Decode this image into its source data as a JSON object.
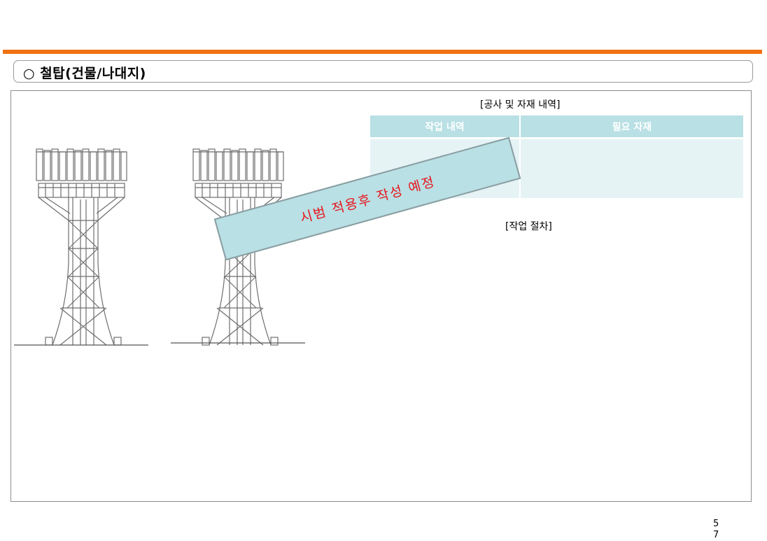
{
  "header": {
    "title": "○ 철탑(건물/나대지)",
    "accent_color": "#f07213"
  },
  "table": {
    "caption": "[공사 및 자재 내역]",
    "col1_header": "작업 내역",
    "col2_header": "필요 자재",
    "header_color": "#b9e0e4",
    "body_color": "#e5f3f5"
  },
  "procedure": {
    "caption": "[작업 절차]"
  },
  "stamp": {
    "text": "시범 적용후 작성 예정",
    "text_color": "#e8141c"
  },
  "page": {
    "number_line1": "5",
    "number_line2": "7"
  },
  "figures": {
    "towers": [
      "tower-drawing-1",
      "tower-drawing-2"
    ]
  }
}
